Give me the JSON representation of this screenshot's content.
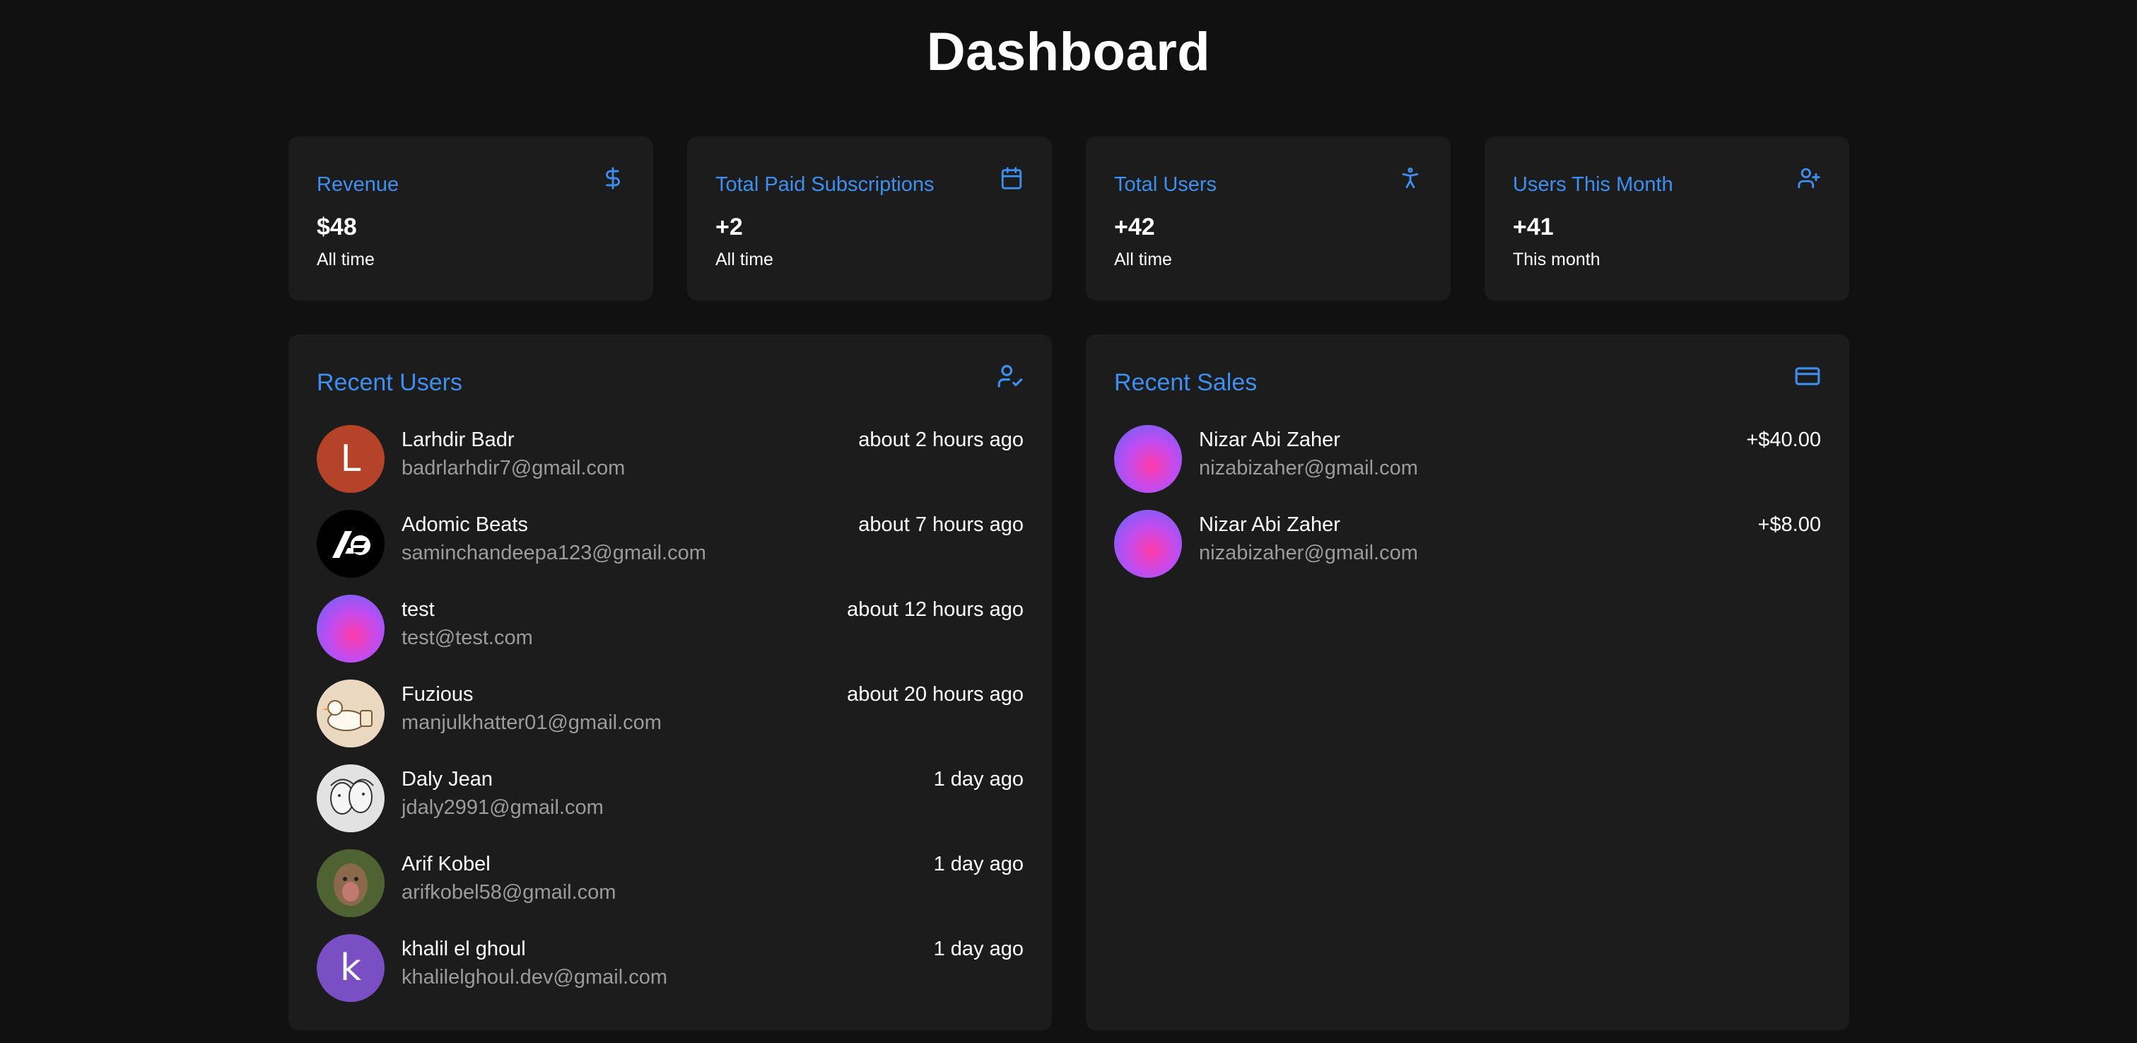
{
  "page": {
    "title": "Dashboard"
  },
  "stats": [
    {
      "title": "Revenue",
      "value": "$48",
      "sub": "All time",
      "icon": "dollar-icon"
    },
    {
      "title": "Total Paid Subscriptions",
      "value": "+2",
      "sub": "All time",
      "icon": "calendar-icon"
    },
    {
      "title": "Total Users",
      "value": "+42",
      "sub": "All time",
      "icon": "person-icon"
    },
    {
      "title": "Users This Month",
      "value": "+41",
      "sub": "This month",
      "icon": "user-plus-icon"
    }
  ],
  "recent_users": {
    "title": "Recent Users",
    "icon": "user-check-icon",
    "items": [
      {
        "name": "Larhdir Badr",
        "email": "badrlarhdir7@gmail.com",
        "time": "about 2 hours ago",
        "avatar_letter": "L",
        "avatar_color": "#b5432a"
      },
      {
        "name": "Adomic Beats",
        "email": "saminchandeepa123@gmail.com",
        "time": "about 7 hours ago",
        "avatar_letter": "",
        "avatar_color": "#000000"
      },
      {
        "name": "test",
        "email": "test@test.com",
        "time": "about 12 hours ago",
        "avatar_letter": "",
        "avatar_color": "gradient"
      },
      {
        "name": "Fuzious",
        "email": "manjulkhatter01@gmail.com",
        "time": "about 20 hours ago",
        "avatar_letter": "",
        "avatar_color": "#ead8c0"
      },
      {
        "name": "Daly Jean",
        "email": "jdaly2991@gmail.com",
        "time": "1 day ago",
        "avatar_letter": "",
        "avatar_color": "#d9d9d9"
      },
      {
        "name": "Arif Kobel",
        "email": "arifkobel58@gmail.com",
        "time": "1 day ago",
        "avatar_letter": "",
        "avatar_color": "#5b6a3a"
      },
      {
        "name": "khalil el ghoul",
        "email": "khalilelghoul.dev@gmail.com",
        "time": "1 day ago",
        "avatar_letter": "k",
        "avatar_color": "#7a4fc4"
      }
    ]
  },
  "recent_sales": {
    "title": "Recent Sales",
    "icon": "credit-card-icon",
    "items": [
      {
        "name": "Nizar Abi Zaher",
        "email": "nizabizaher@gmail.com",
        "amount": "+$40.00"
      },
      {
        "name": "Nizar Abi Zaher",
        "email": "nizabizaher@gmail.com",
        "amount": "+$8.00"
      }
    ]
  },
  "colors": {
    "background": "#111111",
    "card": "#1c1c1c",
    "accent": "#3d8ff0",
    "muted": "#9b9b9b"
  }
}
